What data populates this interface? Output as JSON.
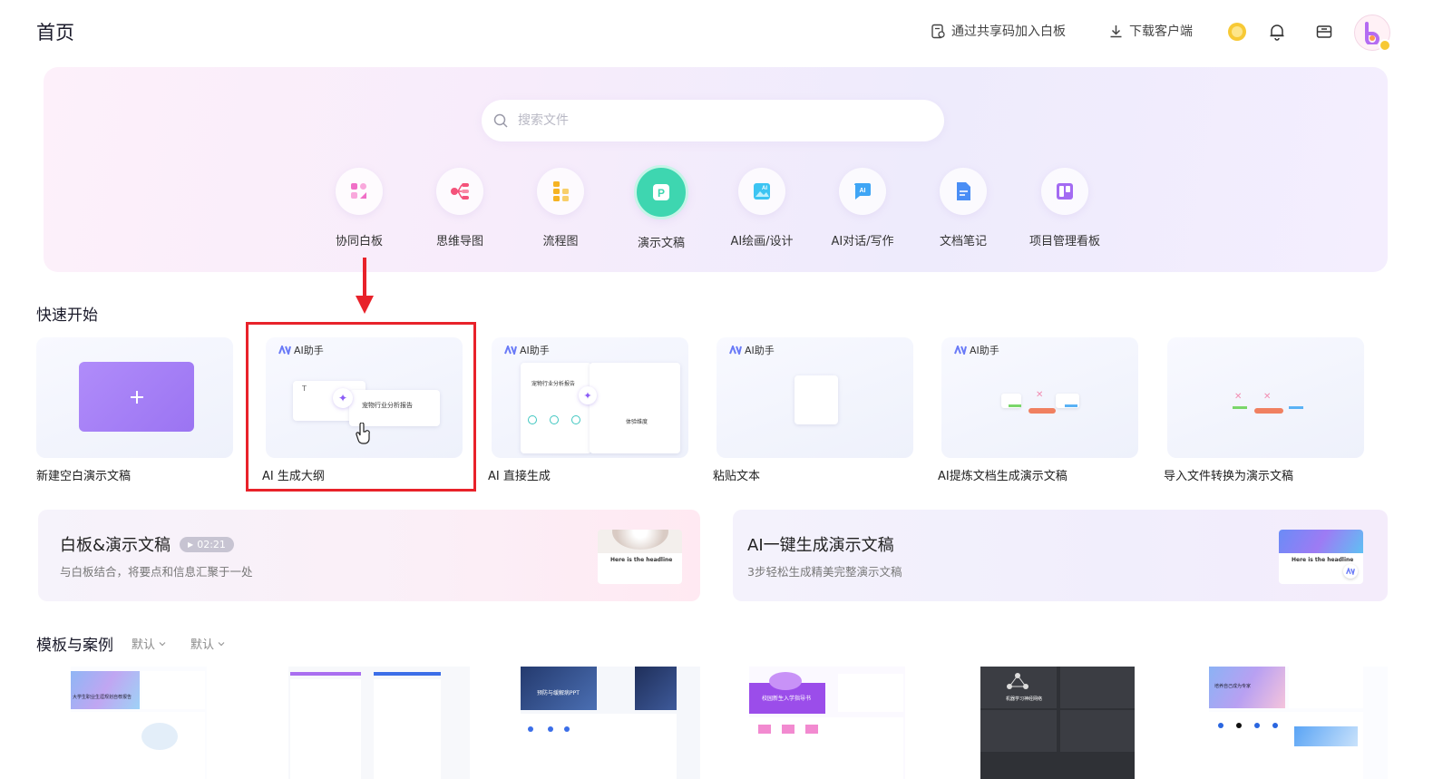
{
  "header": {
    "title": "首页",
    "join_link": "通过共享码加入白板",
    "download_link": "下载客户端"
  },
  "search": {
    "placeholder": "搜索文件"
  },
  "categories": [
    {
      "label": "协同白板",
      "icon": "whiteboard-icon",
      "color": "#f06fc7"
    },
    {
      "label": "思维导图",
      "icon": "mindmap-icon",
      "color": "#f4527a"
    },
    {
      "label": "流程图",
      "icon": "flowchart-icon",
      "color": "#f5b322"
    },
    {
      "label": "演示文稿",
      "icon": "presentation-icon",
      "color": "#3ed6b0",
      "active": true
    },
    {
      "label": "AI绘画/设计",
      "icon": "ai-image-icon",
      "color": "#3cc4f2"
    },
    {
      "label": "AI对话/写作",
      "icon": "ai-chat-icon",
      "color": "#3fa5f5"
    },
    {
      "label": "文档笔记",
      "icon": "doc-icon",
      "color": "#4a8ef5"
    },
    {
      "label": "项目管理看板",
      "icon": "kanban-icon",
      "color": "#a36bf2"
    }
  ],
  "quick_start": {
    "title": "快速开始",
    "ai_badge": "AI助手",
    "cards": [
      {
        "label": "新建空白演示文稿"
      },
      {
        "label": "AI 生成大纲",
        "preview_text": "宠物行业分析报告",
        "highlighted": true
      },
      {
        "label": "AI 直接生成",
        "preview_text": "宠物行业分析报告",
        "preview_text2": "体验维度"
      },
      {
        "label": "粘贴文本"
      },
      {
        "label": "AI提炼文档生成演示文稿"
      },
      {
        "label": "导入文件转换为演示文稿"
      }
    ]
  },
  "banners": [
    {
      "title": "白板&演示文稿",
      "duration": "02:21",
      "subtitle": "与白板结合，将要点和信息汇聚于一处",
      "thumb_text": "Here is the headline"
    },
    {
      "title": "AI一键生成演示文稿",
      "subtitle": "3步轻松生成精美完整演示文稿",
      "thumb_text": "Here is the headline"
    }
  ],
  "templates": {
    "title": "模板与案例",
    "filter1": "默认",
    "filter2": "默认",
    "cards": [
      {
        "headline": "大学生职业生涯规划自荐报告"
      },
      {
        "headline": ""
      },
      {
        "headline": "预防与缓解病PPT"
      },
      {
        "headline": "校园新生入学指导书"
      },
      {
        "headline": "机器学习神经网络"
      },
      {
        "headline": "培养自己成为专家"
      }
    ]
  },
  "colors": {
    "accent": "#9b74f2",
    "highlight_red": "#e8222a",
    "active_green": "#3ed6b0"
  }
}
